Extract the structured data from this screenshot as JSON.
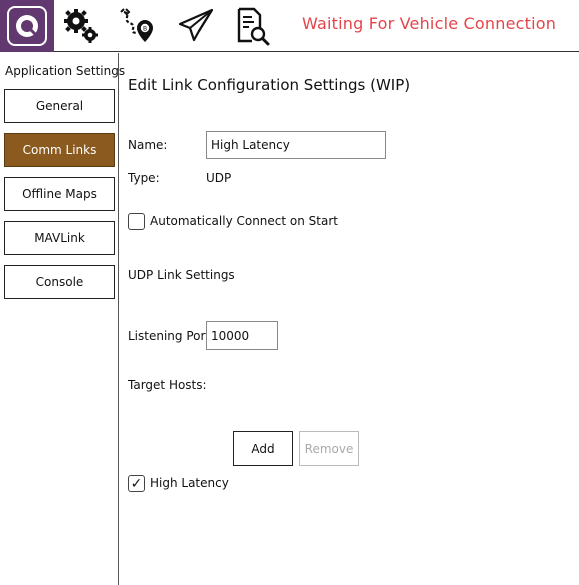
{
  "toolbar": {
    "logo_icon": "qgc-logo-icon",
    "settings_icon": "gears-icon",
    "plan_icon": "plan-route-icon",
    "fly_icon": "paper-plane-icon",
    "analyze_icon": "document-search-icon",
    "status": "Waiting For Vehicle Connection",
    "status_color": "#e4444a",
    "accent": "#61386f"
  },
  "sidebar": {
    "header": "Application Settings",
    "items": [
      {
        "label": "General"
      },
      {
        "label": "Comm Links"
      },
      {
        "label": "Offline Maps"
      },
      {
        "label": "MAVLink"
      },
      {
        "label": "Console"
      }
    ],
    "active_color": "#8b5a1e"
  },
  "main": {
    "title": "Edit Link Configuration Settings (WIP)",
    "name_label": "Name:",
    "name_value": "High Latency",
    "type_label": "Type:",
    "type_value": "UDP",
    "auto_connect_label": "Automatically Connect on Start",
    "auto_connect_checked": false,
    "udp_section_label": "UDP Link Settings",
    "listening_port_label": "Listening Port",
    "listening_port_value": "10000",
    "target_hosts_label": "Target Hosts:",
    "add_label": "Add",
    "remove_label": "Remove",
    "high_latency_label": "High Latency",
    "high_latency_checked": true,
    "check_mark": "✓"
  }
}
